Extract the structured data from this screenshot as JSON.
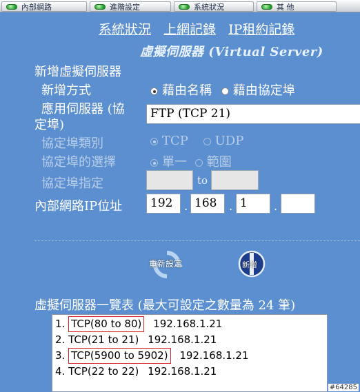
{
  "nav": {
    "tabs": [
      {
        "label": "內部網路"
      },
      {
        "label": "進階設定"
      },
      {
        "label": "系統狀況"
      },
      {
        "label": "其 他"
      }
    ]
  },
  "sublinks": {
    "status": "系統狀況",
    "log": "上網記錄",
    "dhcp": "IP租約記錄"
  },
  "title": "虛擬伺服器 (Virtual Server)",
  "form": {
    "section_label": "新增虛擬伺服器",
    "method_label": "新增方式",
    "method_by_name": "藉由名稱",
    "method_by_port": "藉由協定埠",
    "method_selected": "by_name",
    "server_label_line1": "應用伺服器 (協",
    "server_label_line2": "定埠)",
    "server_value": "FTP (TCP 21)",
    "proto_type_label": "協定埠類別",
    "proto_tcp": "TCP",
    "proto_udp": "UDP",
    "port_select_label": "協定埠的選擇",
    "port_single": "單一",
    "port_range": "範圍",
    "port_spec_label": "協定埠指定",
    "port_from": "",
    "port_to_word": "to",
    "port_to": "",
    "ip_label": "內部網路IP位址",
    "ip": [
      "192",
      "168",
      "1",
      ""
    ]
  },
  "buttons": {
    "reset": "重新設定",
    "add": "新增"
  },
  "list": {
    "title": "虛擬伺服器一覽表 (最大可設定之數量為 24 筆)",
    "items": [
      {
        "num": "1.",
        "proto": "TCP(80 to 80)",
        "ip": "192.168.1.21",
        "boxed": true
      },
      {
        "num": "2.",
        "proto": "TCP(21 to 21)",
        "ip": "192.168.1.21",
        "boxed": false
      },
      {
        "num": "3.",
        "proto": "TCP(5900 to 5902)",
        "ip": "192.168.1.21",
        "boxed": true
      },
      {
        "num": "4.",
        "proto": "TCP(22 to 22)",
        "ip": "192.168.1.21",
        "boxed": false
      }
    ]
  },
  "watermark": "#64285"
}
